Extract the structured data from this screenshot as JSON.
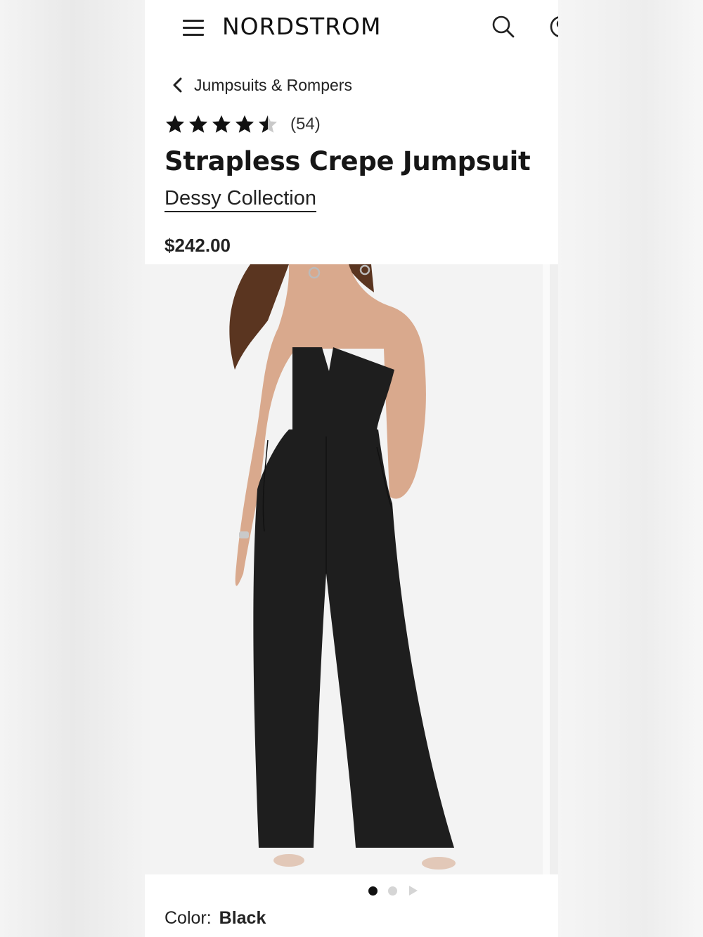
{
  "header": {
    "logo": "NORDSTROM",
    "icons": [
      "menu-icon",
      "search-icon",
      "account-icon"
    ]
  },
  "breadcrumb": {
    "label": "Jumpsuits & Rompers"
  },
  "product": {
    "rating": 4.5,
    "review_count": "(54)",
    "title": "Strapless Crepe Jumpsuit",
    "brand": "Dessy Collection",
    "price": "$242.00"
  },
  "gallery": {
    "total_images": 3,
    "active_index": 0
  },
  "color": {
    "label": "Color:",
    "value": "Black"
  },
  "colors": {
    "star": "#111111",
    "star_empty": "#c9c9c9",
    "garment": "#1e1e1e",
    "skin": "#d9a98d",
    "hair": "#5a3520"
  }
}
